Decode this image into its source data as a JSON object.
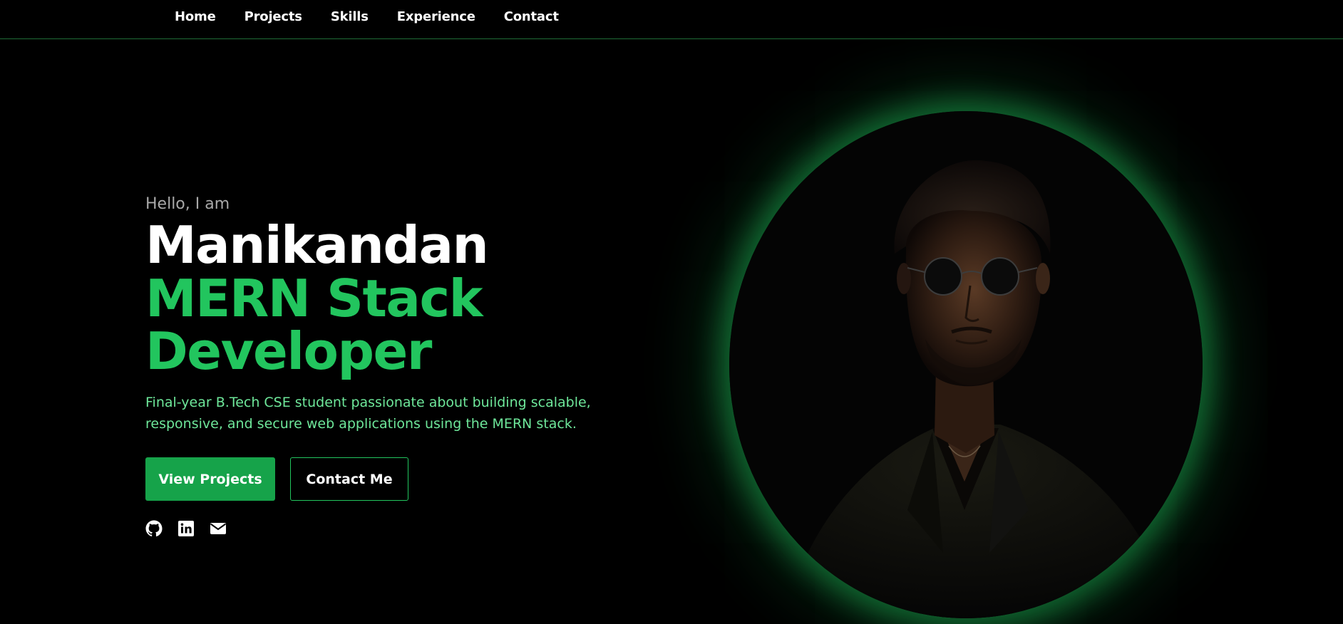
{
  "nav": {
    "items": [
      {
        "label": "Home"
      },
      {
        "label": "Projects"
      },
      {
        "label": "Skills"
      },
      {
        "label": "Experience"
      },
      {
        "label": "Contact"
      }
    ]
  },
  "hero": {
    "greeting": "Hello, I am",
    "name": "Manikandan",
    "role_line1": "MERN Stack",
    "role_line2": "Developer",
    "description": "Final-year B.Tech CSE student passionate about building scalable, responsive, and secure web applications using the MERN stack.",
    "primary_button": "View Projects",
    "secondary_button": "Contact Me"
  },
  "socials": [
    {
      "icon": "github-icon"
    },
    {
      "icon": "linkedin-icon"
    },
    {
      "icon": "mail-icon"
    }
  ],
  "colors": {
    "background": "#000000",
    "accent": "#22c55e",
    "button": "#16a34a",
    "description": "#6ee79a",
    "greeting": "#a9a9a9"
  }
}
